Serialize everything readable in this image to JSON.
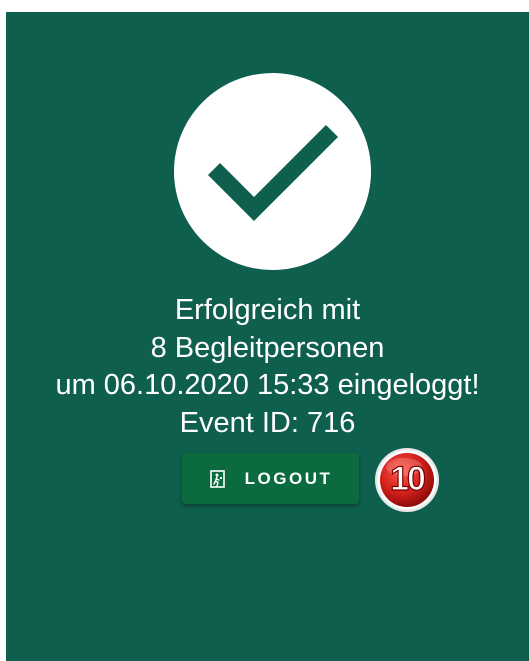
{
  "message": {
    "line1": "Erfolgreich mit",
    "line2": "8 Begleitpersonen",
    "line3": "um 06.10.2020 15:33 eingeloggt!",
    "line4": "Event ID: 716"
  },
  "logout_button": {
    "label": "LOGOUT",
    "icon": "exit-door-icon"
  },
  "badge": {
    "value": "10"
  },
  "success_icon": "checkmark-icon",
  "colors": {
    "background": "#0f5f4f",
    "button": "#0b6b3f",
    "text": "#ffffff",
    "badge": "#d4201c"
  }
}
